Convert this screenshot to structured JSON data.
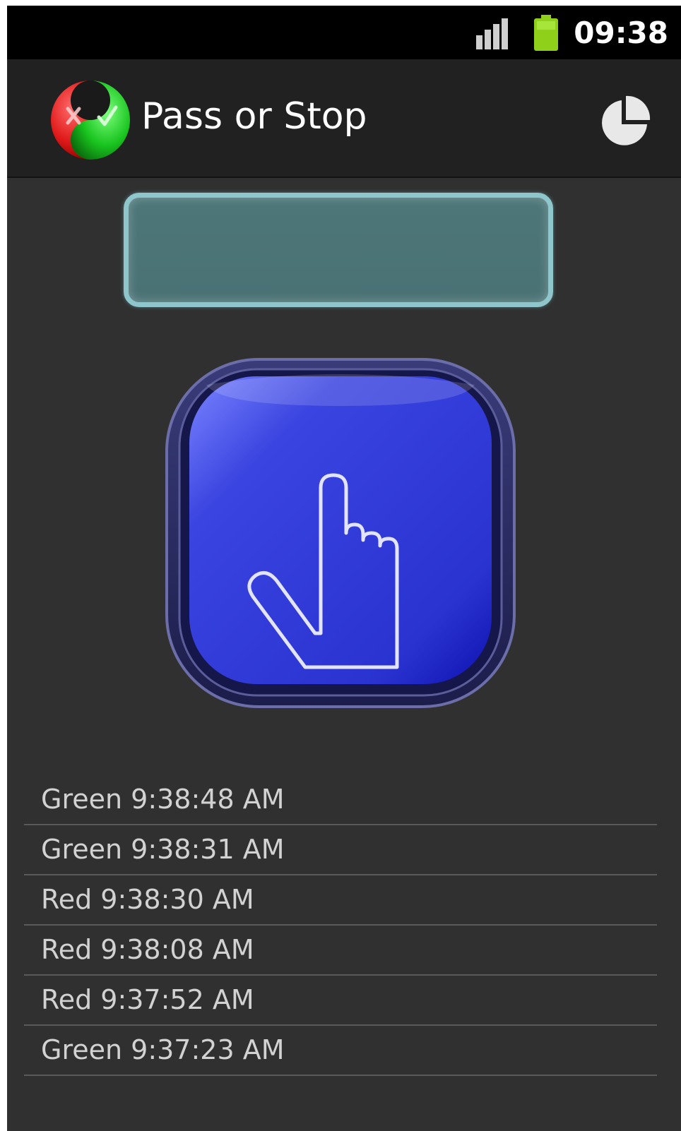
{
  "status_bar": {
    "time": "09:38",
    "icons": [
      "signal-icon",
      "battery-icon"
    ]
  },
  "action_bar": {
    "title": "Pass or Stop",
    "logo_icon": "red-x-green-check-logo-icon",
    "stats_icon": "pie-chart-icon"
  },
  "result": {
    "text": ""
  },
  "tap_button": {
    "icon": "pointing-hand-icon",
    "color": "#2f37d8"
  },
  "history": [
    {
      "label": "Green 9:38:48 AM"
    },
    {
      "label": "Green 9:38:31 AM"
    },
    {
      "label": "Red 9:38:30 AM"
    },
    {
      "label": "Red 9:38:08 AM"
    },
    {
      "label": "Red 9:37:52 AM"
    },
    {
      "label": "Green 9:37:23 AM"
    }
  ]
}
